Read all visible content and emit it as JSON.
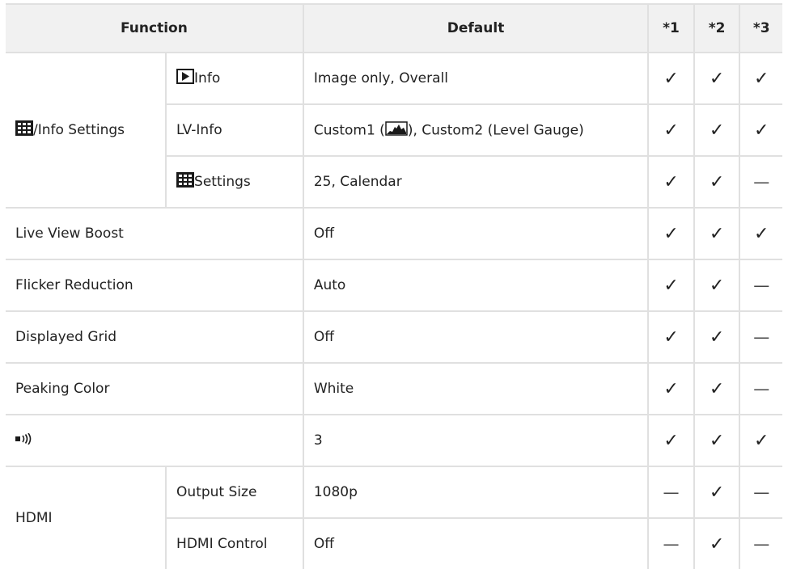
{
  "header": {
    "function": "Function",
    "default": "Default",
    "c1": "*1",
    "c2": "*2",
    "c3": "*3"
  },
  "glyphs": {
    "check": "✓",
    "dash": "—"
  },
  "rows": {
    "info_group": "/Info Settings",
    "play_info": "Info",
    "play_info_default": "Image only, Overall",
    "lv_info": "LV-Info",
    "lv_info_default_a": "Custom1 (",
    "lv_info_default_b": "), Custom2 (Level Gauge)",
    "grid_settings": "Settings",
    "grid_settings_default": "25, Calendar",
    "live_view_boost": "Live View Boost",
    "live_view_boost_default": "Off",
    "flicker": "Flicker Reduction",
    "flicker_default": "Auto",
    "displayed_grid": "Displayed Grid",
    "displayed_grid_default": "Off",
    "peaking": "Peaking Color",
    "peaking_default": "White",
    "beep_default": "3",
    "hdmi": "HDMI",
    "output_size": "Output Size",
    "output_size_default": "1080p",
    "hdmi_control": "HDMI Control",
    "hdmi_control_default": "Off"
  },
  "icons": [
    "grid-view-icon",
    "playback-icon",
    "histogram-icon",
    "beep-sound-icon"
  ],
  "colors": {
    "header_bg": "#f1f1f1",
    "border": "#e0e0e0",
    "text": "#222222"
  }
}
